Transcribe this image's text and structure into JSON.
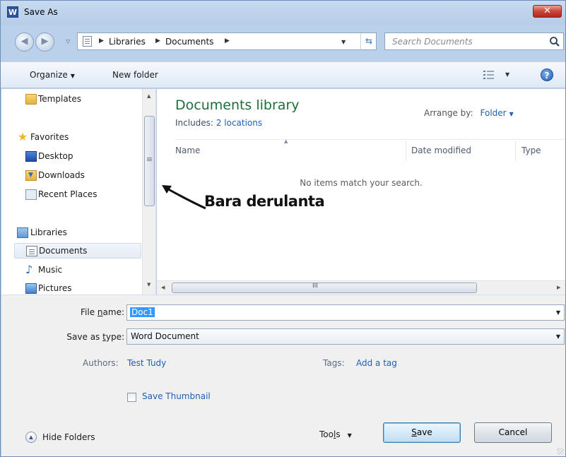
{
  "window": {
    "title": "Save As",
    "app_icon_letter": "W",
    "close_glyph": "✕"
  },
  "address_bar": {
    "crumbs": [
      "Libraries",
      "Documents"
    ],
    "search_placeholder": "Search Documents"
  },
  "toolbar": {
    "organize_label": "Organize",
    "new_folder_label": "New folder",
    "help_glyph": "?"
  },
  "nav_pane": {
    "items": [
      {
        "label": "Templates",
        "icon": "folder-icon"
      },
      {
        "label": "Favorites",
        "icon": "star-icon"
      },
      {
        "label": "Desktop",
        "icon": "desktop-icon"
      },
      {
        "label": "Downloads",
        "icon": "downloads-icon"
      },
      {
        "label": "Recent Places",
        "icon": "recent-places-icon"
      },
      {
        "label": "Libraries",
        "icon": "libraries-icon"
      },
      {
        "label": "Documents",
        "icon": "document-icon",
        "selected": true
      },
      {
        "label": "Music",
        "icon": "music-icon"
      },
      {
        "label": "Pictures",
        "icon": "pictures-icon"
      }
    ]
  },
  "content": {
    "title": "Documents library",
    "includes_label": "Includes:",
    "includes_link": "2 locations",
    "arrange_label": "Arrange by:",
    "arrange_value": "Folder",
    "columns": [
      "Name",
      "Date modified",
      "Type"
    ],
    "empty_message": "No items match your search.",
    "hscroll_grip": "III"
  },
  "annotation": {
    "text": "Bara derulanta"
  },
  "form": {
    "file_name_label_pre": "File ",
    "file_name_label_u": "n",
    "file_name_label_post": "ame:",
    "file_name_value": "Doc1",
    "save_type_label_pre": "Save as ",
    "save_type_label_u": "t",
    "save_type_label_post": "ype:",
    "save_type_value": "Word Document",
    "authors_label": "Authors:",
    "authors_value": "Test Tudy",
    "tags_label": "Tags:",
    "tags_value": "Add a tag",
    "thumbnail_label": "Save Thumbnail",
    "hide_folders_label": "Hide Folders",
    "tools_label_pre": "Too",
    "tools_label_u": "l",
    "tools_label_post": "s",
    "save_label_u": "S",
    "save_label_post": "ave",
    "cancel_label": "Cancel"
  },
  "colors": {
    "title_link": "#1d6f3a",
    "link": "#1e5fb8",
    "selection": "#3399ff"
  }
}
